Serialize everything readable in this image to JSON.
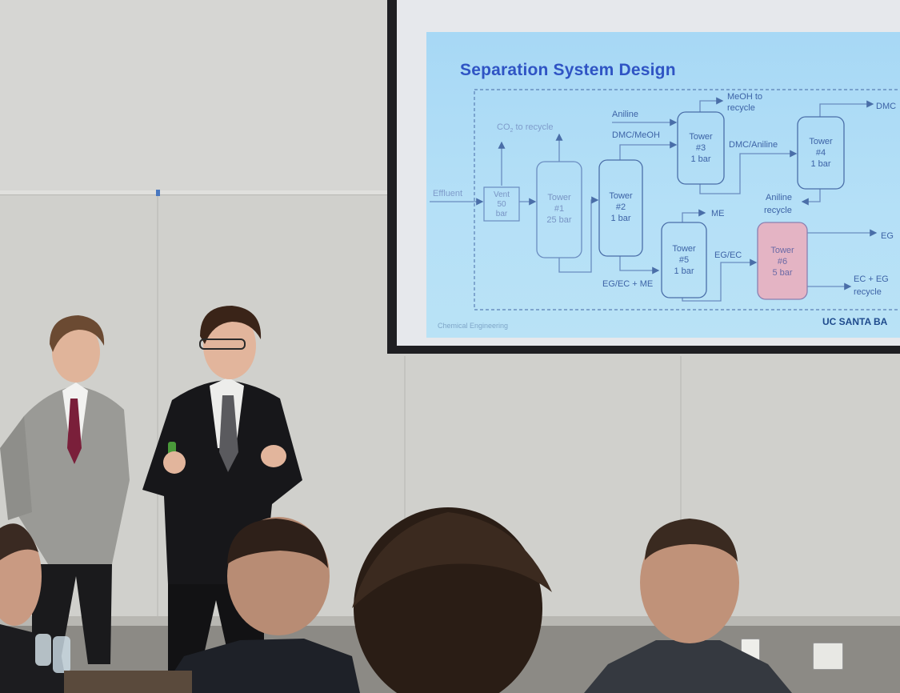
{
  "slide": {
    "title": "Separation System Design",
    "footer_left": "Chemical Engineering",
    "footer_right": "UC SANTA BA"
  },
  "diagram": {
    "effluent": "Effluent",
    "vent_lines": [
      "Vent",
      "50",
      "bar"
    ],
    "co2": "CO",
    "co2_sub": "2",
    "co2_rest": " to recycle",
    "towers": {
      "t1": [
        "Tower",
        "#1",
        "25 bar"
      ],
      "t2": [
        "Tower",
        "#2",
        "1 bar"
      ],
      "t3": [
        "Tower",
        "#3",
        "1 bar"
      ],
      "t4": [
        "Tower",
        "#4",
        "1 bar"
      ],
      "t5": [
        "Tower",
        "#5",
        "1 bar"
      ],
      "t6": [
        "Tower",
        "#6",
        "5 bar"
      ]
    },
    "labels": {
      "aniline": "Aniline",
      "dmc_meoh": "DMC/MeOH",
      "meoh_recycle": [
        "MeOH to",
        "recycle"
      ],
      "dmc_aniline": "DMC/Aniline",
      "dmc_right": "DMC",
      "aniline_recycle": [
        "Aniline",
        "recycle"
      ],
      "me": "ME",
      "eg_ec": "EG/EC",
      "eg_ec_me": "EG/EC + ME",
      "eg": "EG",
      "ec_eg_recycle": [
        "EC + EG",
        "recycle"
      ]
    }
  },
  "colors": {
    "slide_bg": "#a7d8f5",
    "title": "#2f54c4",
    "tower6_fill": "#e4b4c4"
  }
}
